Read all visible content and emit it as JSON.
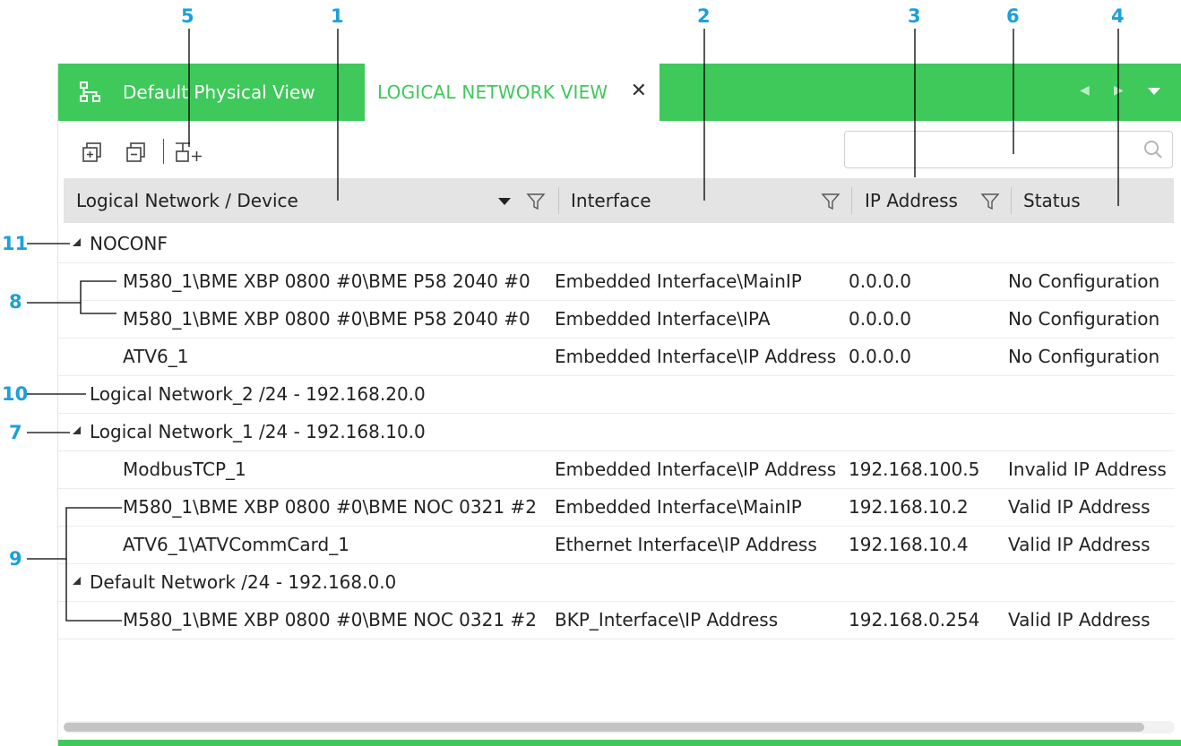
{
  "colors": {
    "accent_green": "#3ec95a",
    "callout_blue": "#1aa0dc",
    "header_gray": "#e4e4e4"
  },
  "callouts": [
    "5",
    "1",
    "2",
    "3",
    "6",
    "4",
    "11",
    "8",
    "10",
    "7",
    "9"
  ],
  "tabs": {
    "physical": {
      "label": "Default Physical View",
      "icon": "network-tree-icon"
    },
    "logical": {
      "label": "LOGICAL NETWORK VIEW",
      "close_label": "✕"
    },
    "nav_prev": "◀",
    "nav_next": "▶"
  },
  "toolbar": {
    "icons": [
      "expand-all-icon",
      "collapse-all-icon",
      "add-logical-network-icon"
    ],
    "search_placeholder": ""
  },
  "columns": {
    "device": "Logical Network / Device",
    "interface": "Interface",
    "ip": "IP Address",
    "status": "Status"
  },
  "rows": [
    {
      "kind": "group",
      "expanded": true,
      "name": "NOCONF"
    },
    {
      "kind": "device",
      "name": "M580_1\\BME XBP 0800 #0\\BME P58 2040 #0",
      "interface": "Embedded Interface\\MainIP",
      "ip": "0.0.0.0",
      "status": "No Configuration"
    },
    {
      "kind": "device",
      "name": "M580_1\\BME XBP 0800 #0\\BME P58 2040 #0",
      "interface": "Embedded Interface\\IPA",
      "ip": "0.0.0.0",
      "status": "No Configuration"
    },
    {
      "kind": "device",
      "name": "ATV6_1",
      "interface": "Embedded Interface\\IP Address",
      "ip": "0.0.0.0",
      "status": "No Configuration"
    },
    {
      "kind": "group",
      "expanded": false,
      "name": "Logical Network_2 /24 - 192.168.20.0"
    },
    {
      "kind": "group",
      "expanded": true,
      "name": "Logical Network_1 /24 - 192.168.10.0"
    },
    {
      "kind": "device",
      "name": "ModbusTCP_1",
      "interface": "Embedded Interface\\IP Address",
      "ip": "192.168.100.5",
      "status": "Invalid IP Address"
    },
    {
      "kind": "device",
      "name": "M580_1\\BME XBP 0800 #0\\BME NOC 0321 #2",
      "interface": "Embedded Interface\\MainIP",
      "ip": "192.168.10.2",
      "status": "Valid IP Address"
    },
    {
      "kind": "device",
      "name": "ATV6_1\\ATVCommCard_1",
      "interface": "Ethernet Interface\\IP Address",
      "ip": "192.168.10.4",
      "status": "Valid IP Address"
    },
    {
      "kind": "group",
      "expanded": true,
      "name": "Default Network /24 - 192.168.0.0"
    },
    {
      "kind": "device",
      "name": "M580_1\\BME XBP 0800 #0\\BME NOC 0321 #2",
      "interface": "BKP_Interface\\IP Address",
      "ip": "192.168.0.254",
      "status": "Valid IP Address"
    }
  ]
}
